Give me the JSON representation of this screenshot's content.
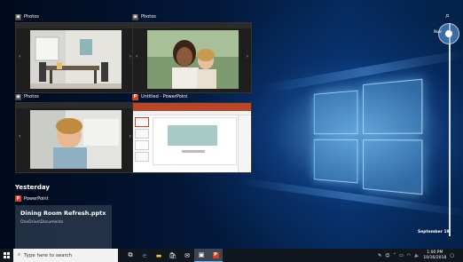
{
  "task_view": {
    "windows": [
      {
        "app": "Photos"
      },
      {
        "app": "Photos"
      },
      {
        "app": "Photos"
      },
      {
        "app": "Untitled - PowerPoint"
      }
    ]
  },
  "timeline": {
    "section": "Yesterday",
    "activity": {
      "app": "PowerPoint",
      "title": "Dining Room Refresh.pptx",
      "subtitle": "OneDrive\\Documents"
    },
    "now_label": "Now",
    "date_label": "September 19"
  },
  "taskbar": {
    "search_placeholder": "Type here to search",
    "time": "1:00 PM",
    "date": "10/16/2018",
    "pinned_icons": [
      "task-view",
      "edge",
      "file-explorer",
      "store",
      "mail",
      "photos",
      "powerpoint"
    ]
  },
  "colors": {
    "accent": "#0078d7",
    "powerpoint": "#d04423"
  }
}
